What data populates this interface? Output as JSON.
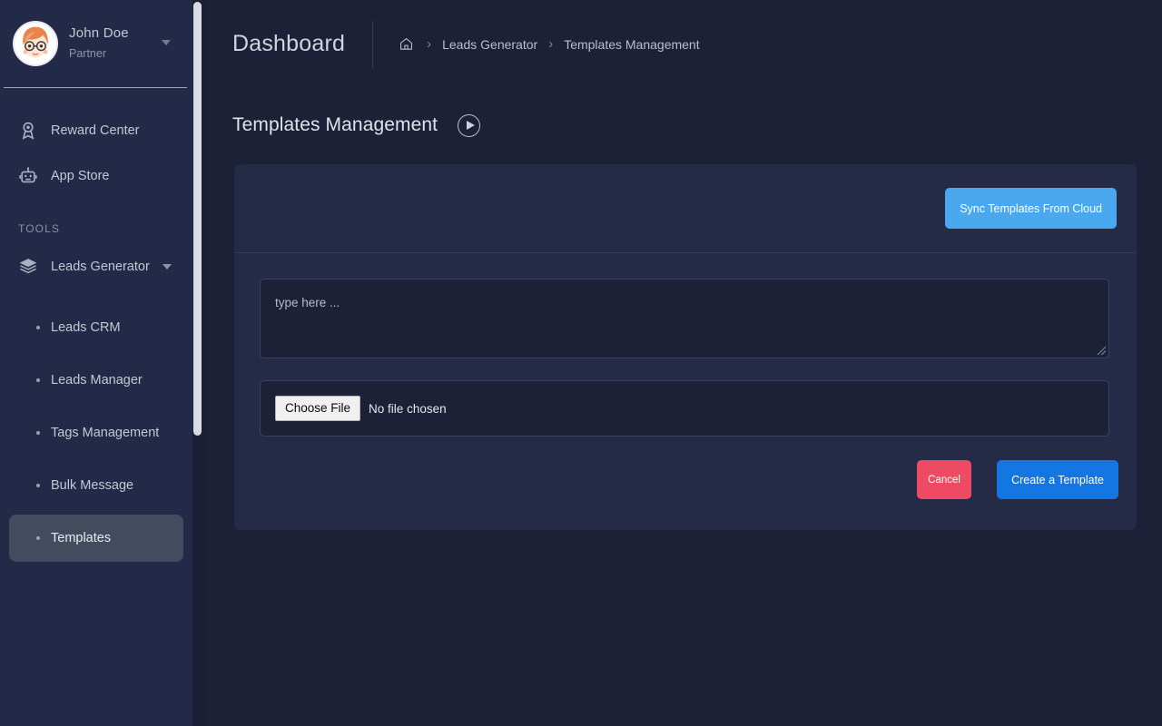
{
  "sidebar": {
    "profile": {
      "name": "John Doe",
      "role": "Partner",
      "avatar_icon": "user-avatar",
      "caret_icon": "caret-down-icon"
    },
    "items": [
      {
        "label": "Reward Center",
        "icon": "award-ribbon-icon"
      },
      {
        "label": "App Store",
        "icon": "robot-icon"
      }
    ],
    "section_label": "TOOLS",
    "group": {
      "label": "Leads Generator",
      "icon": "layers-icon",
      "caret_icon": "caret-down-icon"
    },
    "subitems": [
      {
        "label": "Leads CRM",
        "active": false
      },
      {
        "label": "Leads Manager",
        "active": false
      },
      {
        "label": "Tags Management",
        "active": false
      },
      {
        "label": "Bulk Message",
        "active": false
      },
      {
        "label": "Templates",
        "active": true
      }
    ]
  },
  "topbar": {
    "title": "Dashboard",
    "breadcrumb": {
      "home_icon": "home-icon",
      "separator": "›",
      "items": [
        "Leads Generator",
        "Templates Management"
      ]
    }
  },
  "page": {
    "title": "Templates Management",
    "play_icon": "play-circle-icon"
  },
  "card": {
    "sync_button": "Sync Templates From Cloud",
    "textarea_placeholder": "type here ...",
    "textarea_value": "",
    "file_input": {
      "button_label": "Choose File",
      "status": "No file chosen"
    },
    "cancel_button": "Cancel",
    "create_button": "Create a Template"
  },
  "colors": {
    "page_bg": "#1c2137",
    "sidebar_bg": "#232a47",
    "card_bg": "#252b47",
    "sync_blue": "#4aa8ef",
    "create_blue": "#1476e2",
    "cancel_red": "#ef4a63",
    "active_item": "#444b5f",
    "text_primary": "#dfe3ec",
    "text_muted": "#8d94a8"
  }
}
